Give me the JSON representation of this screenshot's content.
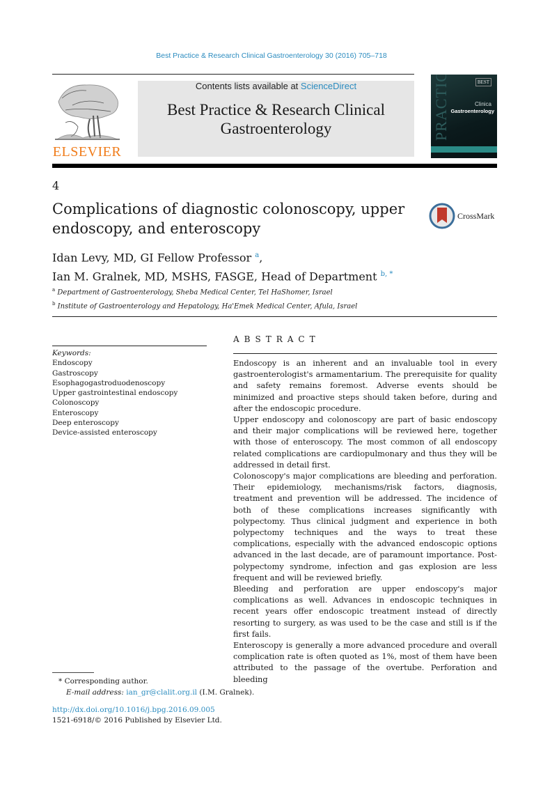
{
  "header": {
    "journal_reference": "Best Practice & Research Clinical Gastroenterology 30 (2016) 705–718",
    "contents_prefix": "Contents lists available at ",
    "contents_link": "ScienceDirect",
    "journal_title_line1": "Best Practice & Research Clinical",
    "journal_title_line2": "Gastroenterology",
    "publisher_logo_text": "ELSEVIER",
    "cover": {
      "badge": "BEST",
      "vertical_text": "PRACTICE",
      "line1": "Clinica",
      "line2": "Gastroenterology"
    }
  },
  "article": {
    "chapter_number": "4",
    "title": "Complications of diagnostic colonoscopy, upper endoscopy, and enteroscopy",
    "crossmark_label": "CrossMark",
    "authors": [
      {
        "name": "Idan Levy, MD, GI Fellow Professor",
        "sup": "a",
        "trail": ","
      },
      {
        "name": "Ian M. Gralnek, MD, MSHS, FASGE, Head of Department",
        "sup": "b, *",
        "trail": ""
      }
    ],
    "affiliations": [
      {
        "sup": "a",
        "text": "Department of Gastroenterology, Sheba Medical Center, Tel HaShomer, Israel"
      },
      {
        "sup": "b",
        "text": "Institute of Gastroenterology and Hepatology, Ha'Emek Medical Center, Afula, Israel"
      }
    ]
  },
  "keywords": {
    "label": "Keywords:",
    "items": [
      "Endoscopy",
      "Gastroscopy",
      "Esophagogastroduodenoscopy",
      "Upper gastrointestinal endoscopy",
      "Colonoscopy",
      "Enteroscopy",
      "Deep enteroscopy",
      "Device-assisted enteroscopy"
    ]
  },
  "abstract": {
    "heading": "ABSTRACT",
    "paragraphs": [
      "Endoscopy is an inherent and an invaluable tool in every gastroenterologist's armamentarium. The prerequisite for quality and safety remains foremost. Adverse events should be minimized and proactive steps should taken before, during and after the endoscopic procedure.",
      "Upper endoscopy and colonoscopy are part of basic endoscopy and their major complications will be reviewed here, together with those of enteroscopy. The most common of all endoscopy related complications are cardiopulmonary and thus they will be addressed in detail first.",
      "Colonoscopy's major complications are bleeding and perforation. Their epidemiology, mechanisms/risk factors, diagnosis, treatment and prevention will be addressed. The incidence of both of these complications increases significantly with polypectomy. Thus clinical judgment and experience in both polypectomy techniques and the ways to treat these complications, especially with the advanced endoscopic options advanced in the last decade, are of paramount importance. Post-polypectomy syndrome, infection and gas explosion are less frequent and will be reviewed briefly.",
      "Bleeding and perforation are upper endoscopy's major complications as well. Advances in endoscopic techniques in recent years offer endoscopic treatment instead of directly resorting to surgery, as was used to be the case and still is if the first fails.",
      "Enteroscopy is generally a more advanced procedure and overall complication rate is often quoted as 1%, most of them have been attributed to the passage of the overtube. Perforation and bleeding"
    ]
  },
  "footnotes": {
    "corresponding_marker": "*",
    "corresponding_text": "Corresponding author.",
    "email_label": "E-mail address:",
    "email": "ian_gr@clalit.org.il",
    "email_suffix": " (I.M. Gralnek).",
    "doi_link": "http://dx.doi.org/10.1016/j.bpg.2016.09.005",
    "copyright": "1521-6918/© 2016 Published by Elsevier Ltd."
  }
}
